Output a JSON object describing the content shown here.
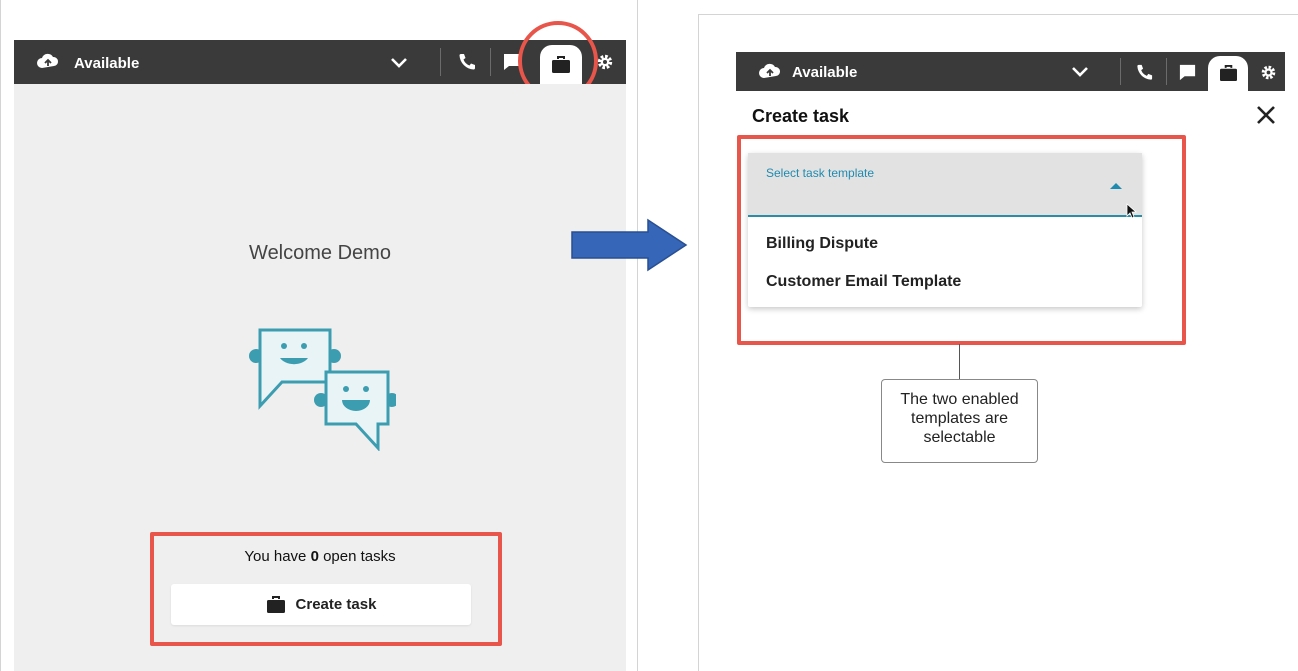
{
  "left": {
    "status": "Available",
    "welcome": "Welcome Demo",
    "tasks_prefix": "You have ",
    "tasks_count": "0",
    "tasks_suffix": " open tasks",
    "create_button": "Create task"
  },
  "right": {
    "status": "Available",
    "title": "Create task",
    "select_label": "Select task template",
    "options": [
      "Billing Dispute",
      "Customer Email Template"
    ],
    "callout": [
      "The two enabled",
      "templates are",
      "selectable"
    ]
  },
  "colors": {
    "toolbar": "#3a3a3a",
    "highlight": "#e8554a",
    "accent": "#1f8bb0",
    "arrow": "#3566b8",
    "bot": "#3d9db0"
  },
  "icons": [
    "cloud-status-icon",
    "chevron-down-icon",
    "phone-icon",
    "chat-icon",
    "briefcase-icon",
    "gear-icon",
    "chatbot-illustration",
    "close-icon",
    "caret-up-icon",
    "cursor-icon",
    "arrow-right-icon"
  ]
}
